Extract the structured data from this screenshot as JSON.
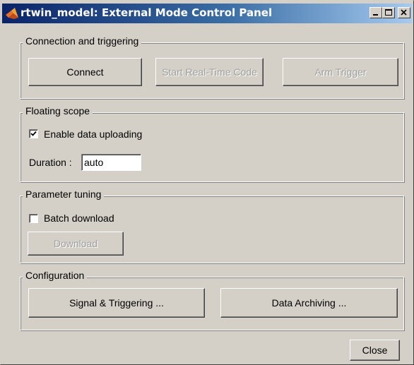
{
  "window": {
    "title": "rtwin_model: External Mode Control Panel",
    "colors": {
      "face": "#d4d0c8",
      "title_start": "#0a246a",
      "title_end": "#a6caf0",
      "disabled_text": "#a0a0a0"
    }
  },
  "connection": {
    "title": "Connection and triggering",
    "connect_label": "Connect",
    "start_label": "Start Real-Time Code",
    "arm_label": "Arm Trigger"
  },
  "floating_scope": {
    "title": "Floating scope",
    "enable_label": "Enable data uploading",
    "enable_checked": true,
    "duration_label": "Duration :",
    "duration_value": "auto"
  },
  "parameter_tuning": {
    "title": "Parameter tuning",
    "batch_label": "Batch download",
    "batch_checked": false,
    "download_label": "Download"
  },
  "configuration": {
    "title": "Configuration",
    "signal_label": "Signal & Triggering ...",
    "archiving_label": "Data Archiving ..."
  },
  "footer": {
    "close_label": "Close"
  },
  "icons": [
    "matlab-logo-icon",
    "minimize-icon",
    "maximize-icon",
    "close-icon",
    "checkmark-icon"
  ]
}
